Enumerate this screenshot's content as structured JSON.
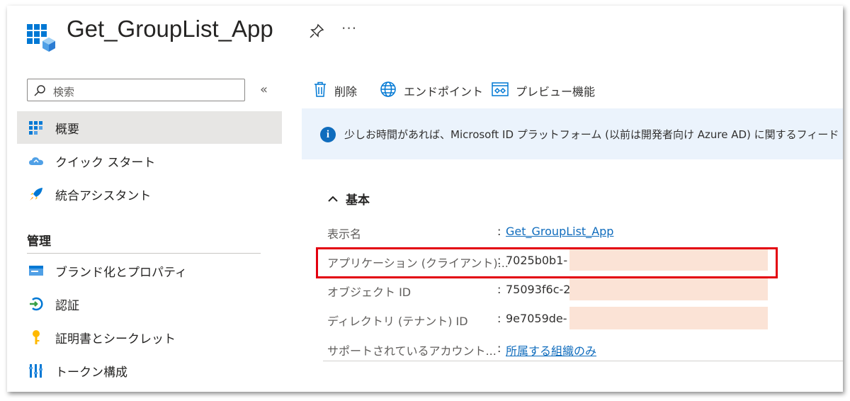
{
  "header": {
    "title": "Get_GroupList_App",
    "pin_icon": "pin-icon",
    "more_label": "···"
  },
  "sidebar": {
    "search_placeholder": "検索",
    "collapse_label": "«",
    "items": [
      {
        "label": "概要",
        "icon": "overview-grid-icon",
        "active": true
      },
      {
        "label": "クイック スタート",
        "icon": "cloud-icon"
      },
      {
        "label": "統合アシスタント",
        "icon": "rocket-icon"
      }
    ],
    "section_title": "管理",
    "manage_items": [
      {
        "label": "ブランド化とプロパティ",
        "icon": "branding-icon"
      },
      {
        "label": "認証",
        "icon": "authentication-icon"
      },
      {
        "label": "証明書とシークレット",
        "icon": "key-icon"
      },
      {
        "label": "トークン構成",
        "icon": "token-icon"
      }
    ]
  },
  "toolbar": {
    "delete_label": "削除",
    "endpoints_label": "エンドポイント",
    "preview_label": "プレビュー機能"
  },
  "banner": {
    "text": "少しお時間があれば、Microsoft ID プラットフォーム (以前は開発者向け Azure AD) に関するフィード"
  },
  "essentials": {
    "title": "基本",
    "rows": [
      {
        "label": "表示名",
        "value": "Get_GroupList_App",
        "is_link": true
      },
      {
        "label": "アプリケーション (クライアント)...",
        "value": "7025b0b1-",
        "redacted": true
      },
      {
        "label": "オブジェクト ID",
        "value": "75093f6c-2",
        "redacted": true
      },
      {
        "label": "ディレクトリ (テナント) ID",
        "value": "9e7059de-",
        "redacted": true
      },
      {
        "label": "サポートされているアカウント...",
        "value": "所属する組織のみ",
        "is_link": true
      }
    ]
  },
  "colors": {
    "accent": "#0f6cbd",
    "highlight_border": "#e3000f",
    "redaction": "#fbe3d6",
    "banner_bg": "#ebf3fc",
    "active_nav_bg": "#e7e6e4"
  }
}
